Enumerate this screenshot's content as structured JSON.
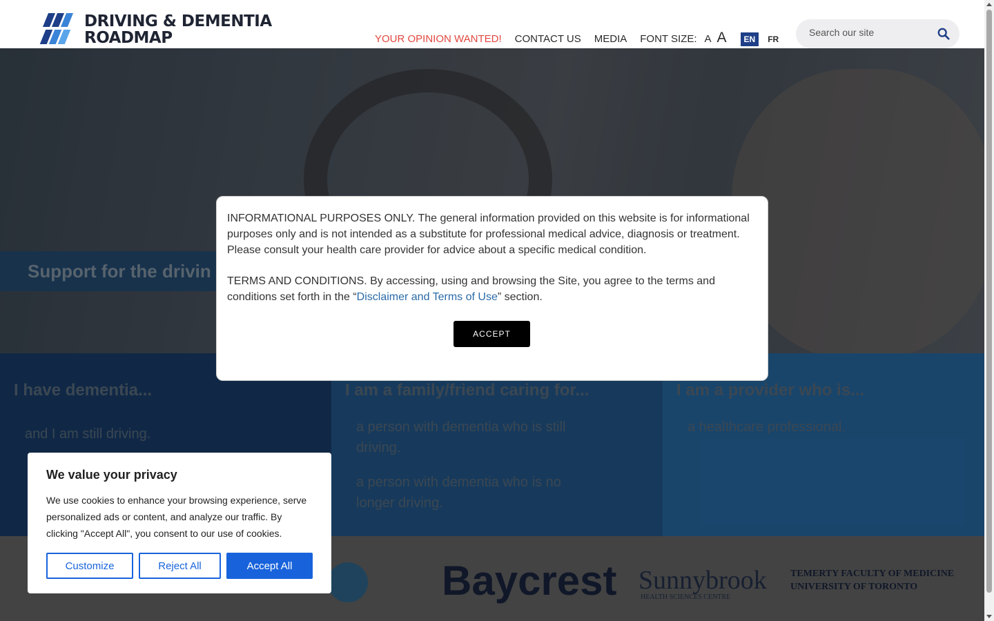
{
  "header": {
    "logo_line1": "DRIVING & DEMENTIA",
    "logo_line2": "ROADMAP",
    "nav": {
      "opinion": "YOUR OPINION WANTED!",
      "contact": "CONTACT US",
      "media": "MEDIA",
      "font_size_label": "FONT SIZE:",
      "font_small": "A",
      "font_large": "A",
      "lang_en": "EN",
      "lang_fr": "FR"
    },
    "search_placeholder": "Search our site"
  },
  "hero": {
    "tagline": "Support for the drivin"
  },
  "audience": [
    {
      "heading": "I have dementia...",
      "lines": [
        "and I am still driving."
      ]
    },
    {
      "heading": "I am a family/friend caring for...",
      "lines": [
        "a person with dementia who is still",
        "driving.",
        "a person with dementia who is no",
        "longer driving."
      ]
    },
    {
      "heading": "I am a provider who is...",
      "lines": [
        "a healthcare professional."
      ]
    }
  ],
  "partners": {
    "names": [
      "Baycrest",
      "Sunnybrook",
      "HEALTH SCIENCES CENTRE",
      "TEMERTY FACULTY OF MEDICINE",
      "UNIVERSITY OF TORONTO"
    ]
  },
  "modal": {
    "para1": "INFORMATIONAL PURPOSES ONLY. The general information provided on this website is for informational purposes only and is not intended as a substitute for professional medical advice, diagnosis or treatment. Please consult your health care provider for advice about a specific medical condition.",
    "para2_prefix": " TERMS AND CONDITIONS. By accessing, using and browsing the Site, you agree to the terms and conditions set forth in the “",
    "para2_link": "Disclaimer and Terms of Use",
    "para2_suffix": "” section.",
    "accept_label": "ACCEPT"
  },
  "cookie": {
    "title": "We value your privacy",
    "description": "We use cookies to enhance your browsing experience, serve personalized ads or content, and analyze our traffic. By clicking \"Accept All\", you consent to our use of cookies.",
    "customize": "Customize",
    "reject": "Reject All",
    "accept": "Accept All"
  },
  "colors": {
    "brand_navy": "#1e3f87",
    "accent_red": "#e2473f",
    "cookie_blue": "#1863dc",
    "link_blue": "#2a6aa8"
  },
  "icons": {
    "search": "search-icon"
  }
}
